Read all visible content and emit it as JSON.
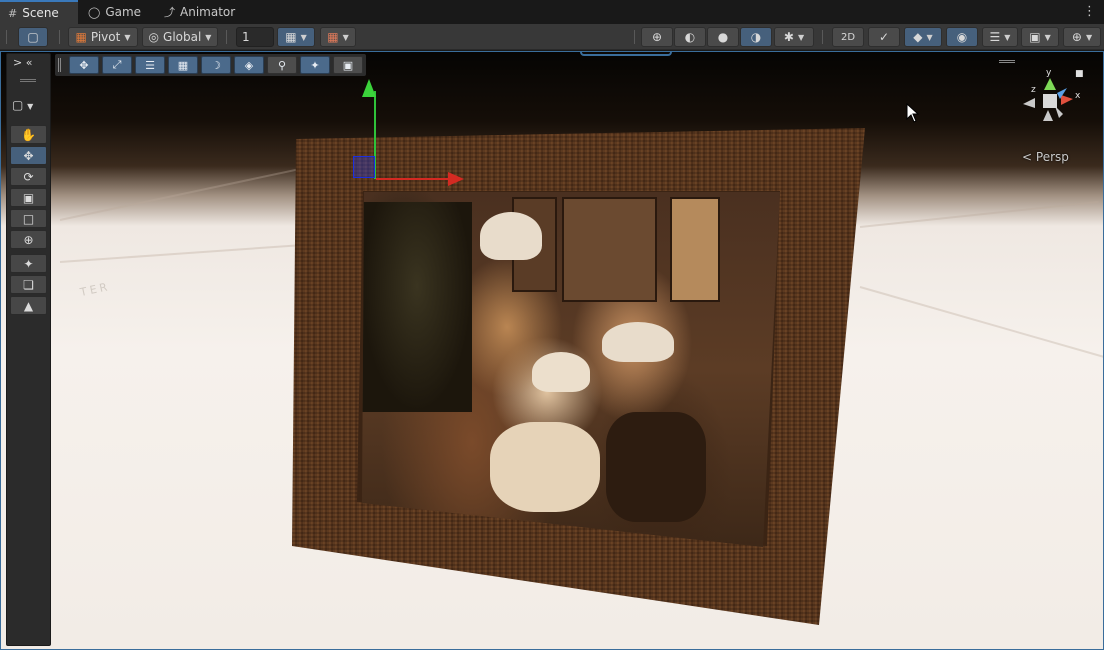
{
  "tabs": [
    {
      "label": "Scene",
      "icon": "grid-icon"
    },
    {
      "label": "Game",
      "icon": "gamepad-icon"
    },
    {
      "label": "Animator",
      "icon": "animator-icon"
    }
  ],
  "toolbar": {
    "pivot_label": "Pivot",
    "global_label": "Global",
    "grid_snap_value": "1"
  },
  "scene": {
    "perspective_label": "Persp",
    "floor_watermark": "TER",
    "gizmo_axes": {
      "y": "y",
      "x": "x",
      "z": "z"
    }
  },
  "colors": {
    "accent": "#3a79bb",
    "toggle_on": "#46607c",
    "axis_x": "#d42a22",
    "axis_y": "#2fc23a",
    "axis_z": "#1a2ee0"
  }
}
